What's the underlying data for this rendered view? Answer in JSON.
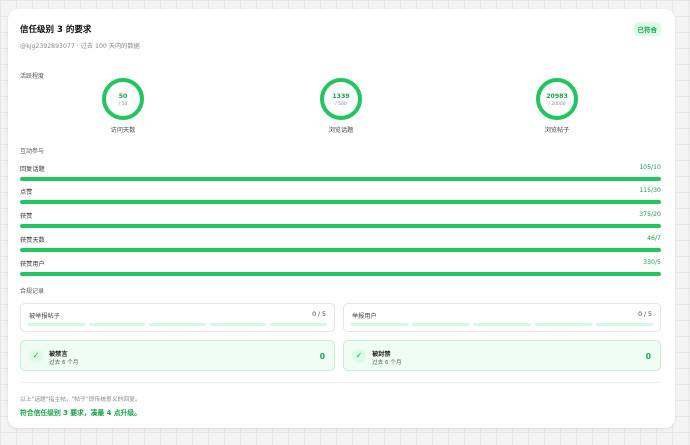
{
  "header": {
    "title": "信任级别 3 的要求",
    "badge": "已符合",
    "subtitle": "@kjg2392893077 · 过去 100 天内的数据"
  },
  "activity": {
    "label": "活跃程度",
    "rings": [
      {
        "value": "50",
        "target": "/ 50",
        "label": "访问天数",
        "progress": 1.0
      },
      {
        "value": "1339",
        "target": "/ 500",
        "label": "浏览话题",
        "progress": 1.0
      },
      {
        "value": "20983",
        "target": "/ 20000",
        "label": "浏览帖子",
        "progress": 1.0
      }
    ]
  },
  "interaction": {
    "label": "互动参与",
    "bars": [
      {
        "label": "回复话题",
        "value": "105/10",
        "progress": 1.0
      },
      {
        "label": "点赞",
        "value": "115/30",
        "progress": 1.0
      },
      {
        "label": "获赞",
        "value": "375/20",
        "progress": 1.0
      },
      {
        "label": "获赞天数",
        "value": "46/7",
        "progress": 1.0
      },
      {
        "label": "获赞用户",
        "value": "330/5",
        "progress": 1.0
      }
    ]
  },
  "compliance": {
    "label": "合规记录",
    "reports": [
      {
        "label": "被举报帖子",
        "value": "0 / 5"
      },
      {
        "label": "举报用户",
        "value": "0 / 5"
      }
    ],
    "bans": [
      {
        "title": "被禁言",
        "sub": "过去 6 个月",
        "count": "0"
      },
      {
        "title": "被封禁",
        "sub": "过去 6 个月",
        "count": "0"
      }
    ]
  },
  "footer": {
    "note": "以上\"话题\"指主帖，\"帖子\"即传统意义的回复。",
    "summary": "符合信任级别 3 要求，凑最 4 点升级。"
  },
  "colors": {
    "accent": "#22c55e",
    "accent_text": "#16a34a",
    "track": "#e5e7eb"
  }
}
